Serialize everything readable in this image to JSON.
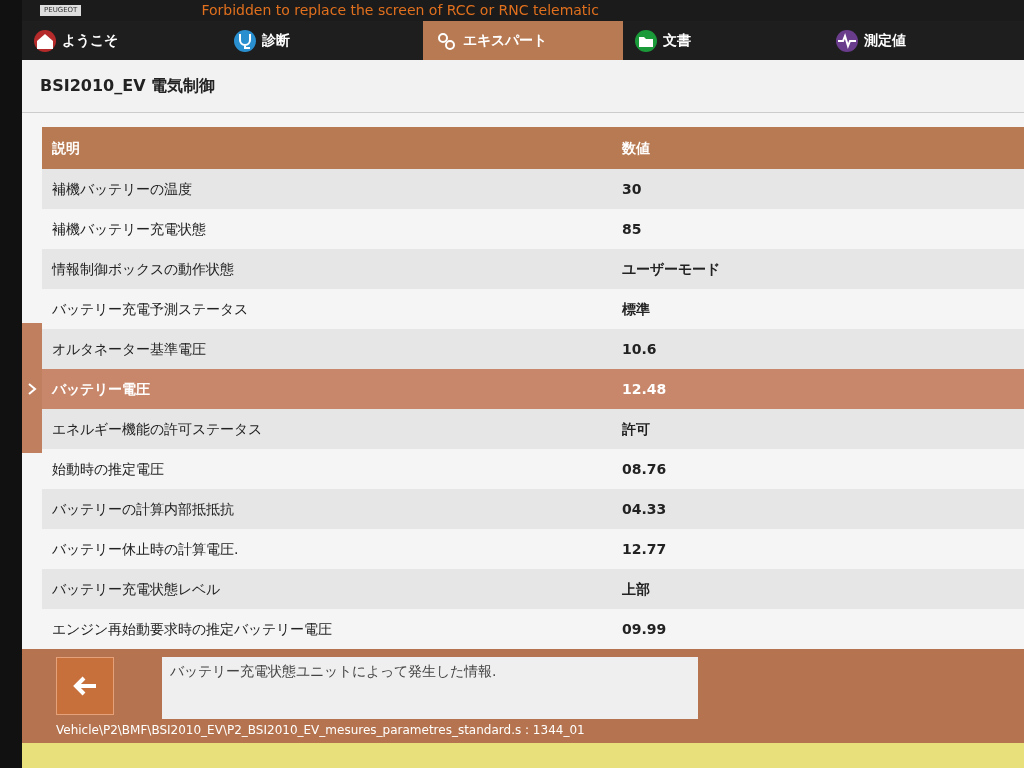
{
  "banner": {
    "logo": "PEUGEOT",
    "warning": "Forbidden to replace the screen of RCC or RNC telematic"
  },
  "tabs": [
    {
      "label": "ようこそ",
      "selected": false
    },
    {
      "label": "診断",
      "selected": false
    },
    {
      "label": "エキスパート",
      "selected": true
    },
    {
      "label": "文書",
      "selected": false
    },
    {
      "label": "測定値",
      "selected": false
    }
  ],
  "page_title": "BSI2010_EV 電気制御",
  "table": {
    "columns": [
      "説明",
      "数値"
    ],
    "rows": [
      {
        "name": "補機バッテリーの温度",
        "value": "30",
        "selected": false
      },
      {
        "name": "補機バッテリー充電状態",
        "value": "85",
        "selected": false
      },
      {
        "name": "情報制御ボックスの動作状態",
        "value": "ユーザーモード",
        "selected": false
      },
      {
        "name": "バッテリー充電予測ステータス",
        "value": "標準",
        "selected": false
      },
      {
        "name": "オルタネーター基準電圧",
        "value": "10.6",
        "selected": false
      },
      {
        "name": "バッテリー電圧",
        "value": "12.48",
        "selected": true
      },
      {
        "name": "エネルギー機能の許可ステータス",
        "value": "許可",
        "selected": false
      },
      {
        "name": "始動時の推定電圧",
        "value": "08.76",
        "selected": false
      },
      {
        "name": "バッテリーの計算内部抵抵抗",
        "value": "04.33",
        "selected": false
      },
      {
        "name": "バッテリー休止時の計算電圧.",
        "value": "12.77",
        "selected": false
      },
      {
        "name": "バッテリー充電状態レベル",
        "value": "上部",
        "selected": false
      },
      {
        "name": "エンジン再始動要求時の推定バッテリー電圧",
        "value": "09.99",
        "selected": false
      }
    ]
  },
  "info": "バッテリー充電状態ユニットによって発生した情報.",
  "path": "Vehicle\\P2\\BMF\\BSI2010_EV\\P2_BSI2010_EV_mesures_parametres_standard.s : 1344_01"
}
